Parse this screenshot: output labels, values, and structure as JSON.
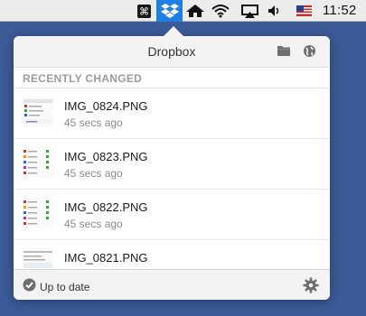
{
  "menubar": {
    "icons": [
      "command-key-icon",
      "dropbox-icon",
      "home-icon",
      "wifi-icon",
      "airplay-icon",
      "volume-icon",
      "us-flag-icon"
    ],
    "clock": "11:52",
    "colors": {
      "dropbox_highlight": "#1f7fe5",
      "bar": "#ececec"
    }
  },
  "popover": {
    "title": "Dropbox",
    "header_icons": [
      "folder-icon",
      "globe-icon"
    ],
    "section_label": "RECENTLY CHANGED",
    "items": [
      {
        "name": "IMG_0824.PNG",
        "time": "45 secs ago",
        "thumb": "screenshot-thumbnail"
      },
      {
        "name": "IMG_0823.PNG",
        "time": "45 secs ago",
        "thumb": "screenshot-thumbnail"
      },
      {
        "name": "IMG_0822.PNG",
        "time": "45 secs ago",
        "thumb": "screenshot-thumbnail"
      },
      {
        "name": "IMG_0821.PNG",
        "time": "",
        "thumb": "screenshot-thumbnail"
      }
    ],
    "footer": {
      "status": "Up to date",
      "status_icon": "check-circle-icon",
      "settings_icon": "gear-icon"
    }
  },
  "background_color": "#3b5a96"
}
